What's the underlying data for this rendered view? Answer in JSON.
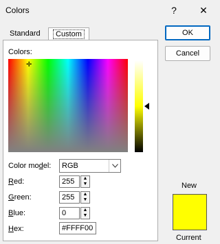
{
  "window": {
    "title": "Colors",
    "help": "?",
    "close": "✕"
  },
  "tabs": [
    {
      "label": "Standard"
    },
    {
      "label": "Custom"
    }
  ],
  "colors_label": "Colors:",
  "color_model": {
    "label_pre": "Color mo",
    "label_ul": "d",
    "label_post": "el:",
    "value": "RGB"
  },
  "red": {
    "label_ul": "R",
    "label_post": "ed:",
    "value": "255"
  },
  "green": {
    "label_ul": "G",
    "label_post": "reen:",
    "value": "255"
  },
  "blue": {
    "label_ul": "B",
    "label_post": "lue:",
    "value": "0"
  },
  "hex": {
    "label_ul": "H",
    "label_post": "ex:",
    "value": "#FFFF00"
  },
  "buttons": {
    "ok": "OK",
    "cancel": "Cancel"
  },
  "preview": {
    "new_label": "New",
    "current_label": "Current",
    "color": "#FFFF00"
  },
  "icons": {
    "dropdown": "chevron-down-icon",
    "spin_up": "▲",
    "spin_down": "▼"
  }
}
